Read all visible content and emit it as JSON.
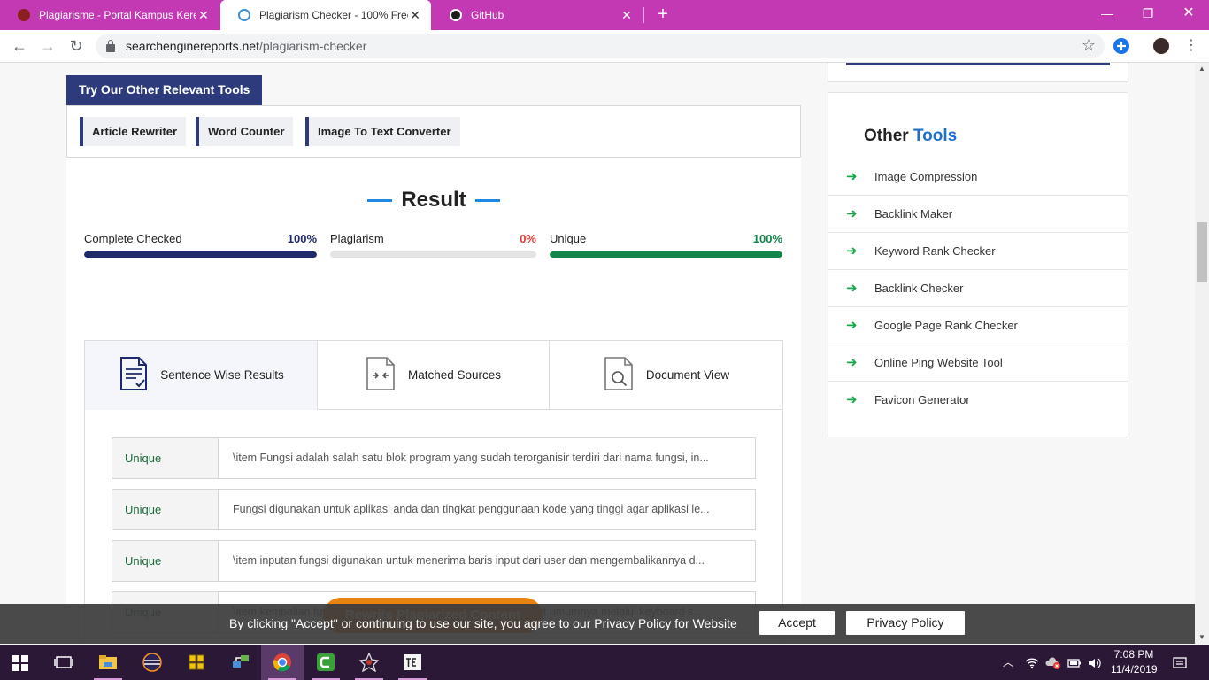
{
  "browser": {
    "tabs": [
      {
        "title": "Plagiarisme - Portal Kampus Kere",
        "active": false
      },
      {
        "title": "Plagiarism Checker - 100% Free t",
        "active": true
      },
      {
        "title": "GitHub",
        "active": false
      }
    ],
    "url_domain": "searchenginereports.net",
    "url_path": "/plagiarism-checker"
  },
  "tools": {
    "heading": "Try Our Other Relevant Tools",
    "items": [
      "Article Rewriter",
      "Word Counter",
      "Image To Text Converter"
    ]
  },
  "result": {
    "title": "Result",
    "stats": [
      {
        "label": "Complete Checked",
        "percent_text": "100%",
        "value": 100,
        "color": "#1e2a6b",
        "pct_color": "#1e2a6b"
      },
      {
        "label": "Plagiarism",
        "percent_text": "0%",
        "value": 0,
        "color": "#e53935",
        "pct_color": "#e53935"
      },
      {
        "label": "Unique",
        "percent_text": "100%",
        "value": 100,
        "color": "#13854a",
        "pct_color": "#13854a"
      }
    ],
    "tabs": [
      "Sentence Wise Results",
      "Matched Sources",
      "Document View"
    ],
    "rows": [
      {
        "status": "Unique",
        "text": "\\item Fungsi adalah salah satu blok program yang sudah terorganisir terdiri dari nama fungsi, in..."
      },
      {
        "status": "Unique",
        "text": "Fungsi digunakan untuk aplikasi anda dan tingkat penggunaan kode yang tinggi agar aplikasi le..."
      },
      {
        "status": "Unique",
        "text": "\\item inputan fungsi digunakan untuk menerima baris input dari user dan mengembalikannya d..."
      },
      {
        "status": "Unique",
        "text": "\\item kembalian fungsi yaitu fungsi akan membaca sebaris input umumnya melalui keyboard s..."
      }
    ],
    "rewrite_button": "Rewrite Plagiarized Content"
  },
  "sidebar": {
    "title_plain": "Other",
    "title_accent": "Tools",
    "items": [
      "Image Compression",
      "Backlink Maker",
      "Keyword Rank Checker",
      "Backlink Checker",
      "Google Page Rank Checker",
      "Online Ping Website Tool",
      "Favicon Generator"
    ]
  },
  "cookie": {
    "text": "By clicking \"Accept\" or continuing to use our site, you agree to our Privacy Policy for Website",
    "accept": "Accept",
    "privacy": "Privacy Policy"
  },
  "taskbar": {
    "time": "7:08 PM",
    "date": "11/4/2019"
  },
  "colors": {
    "tabstrip": "#c239b3",
    "brand_navy": "#2d3a7c",
    "accent_blue": "#1f6fd0",
    "unique_green": "#13854a",
    "rewrite_orange": "#e9830f"
  }
}
